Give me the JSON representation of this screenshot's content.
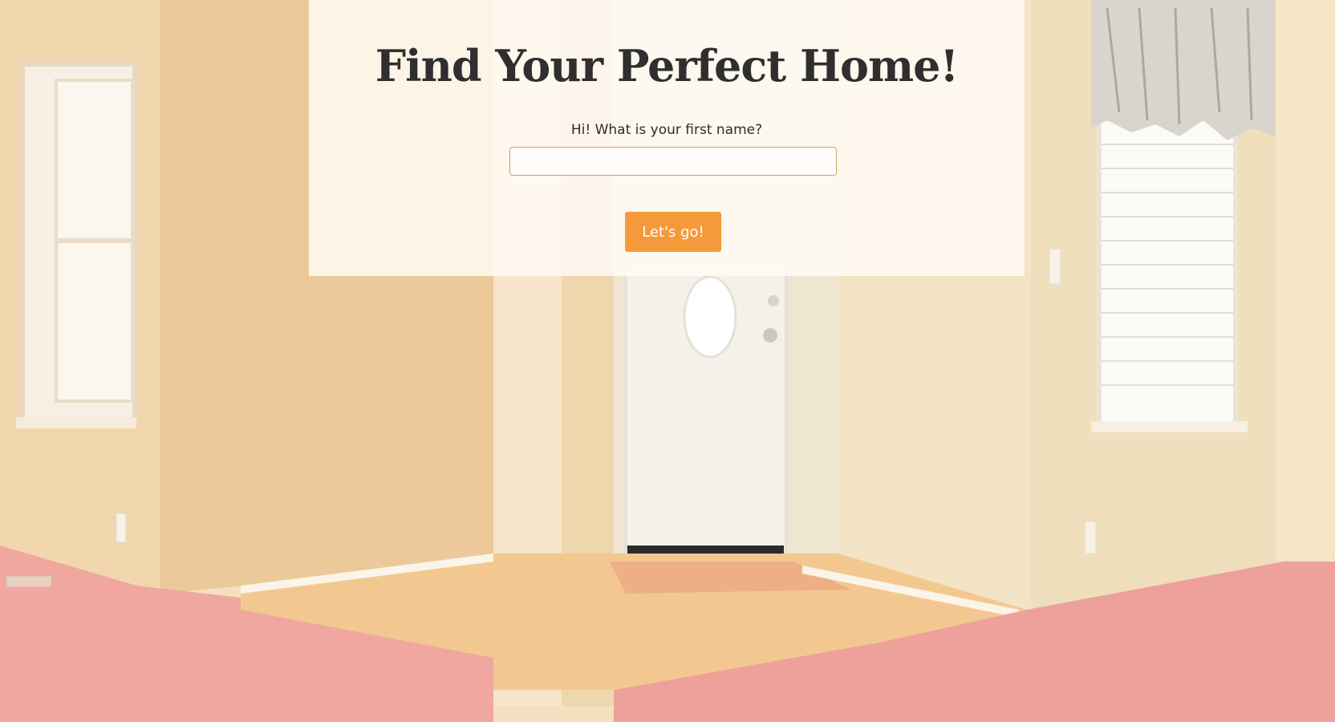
{
  "page": {
    "title": "Find Your Perfect Home!",
    "prompt": "Hi! What is your first name?",
    "name_input": {
      "value": "",
      "placeholder": ""
    },
    "submit_label": "Let's go!"
  },
  "colors": {
    "button": "#f59a3a",
    "title": "#2f2f2f",
    "input_border": "#c9a46a",
    "panel": "#fffaf4"
  },
  "background": {
    "icon": "empty-room-photo"
  }
}
